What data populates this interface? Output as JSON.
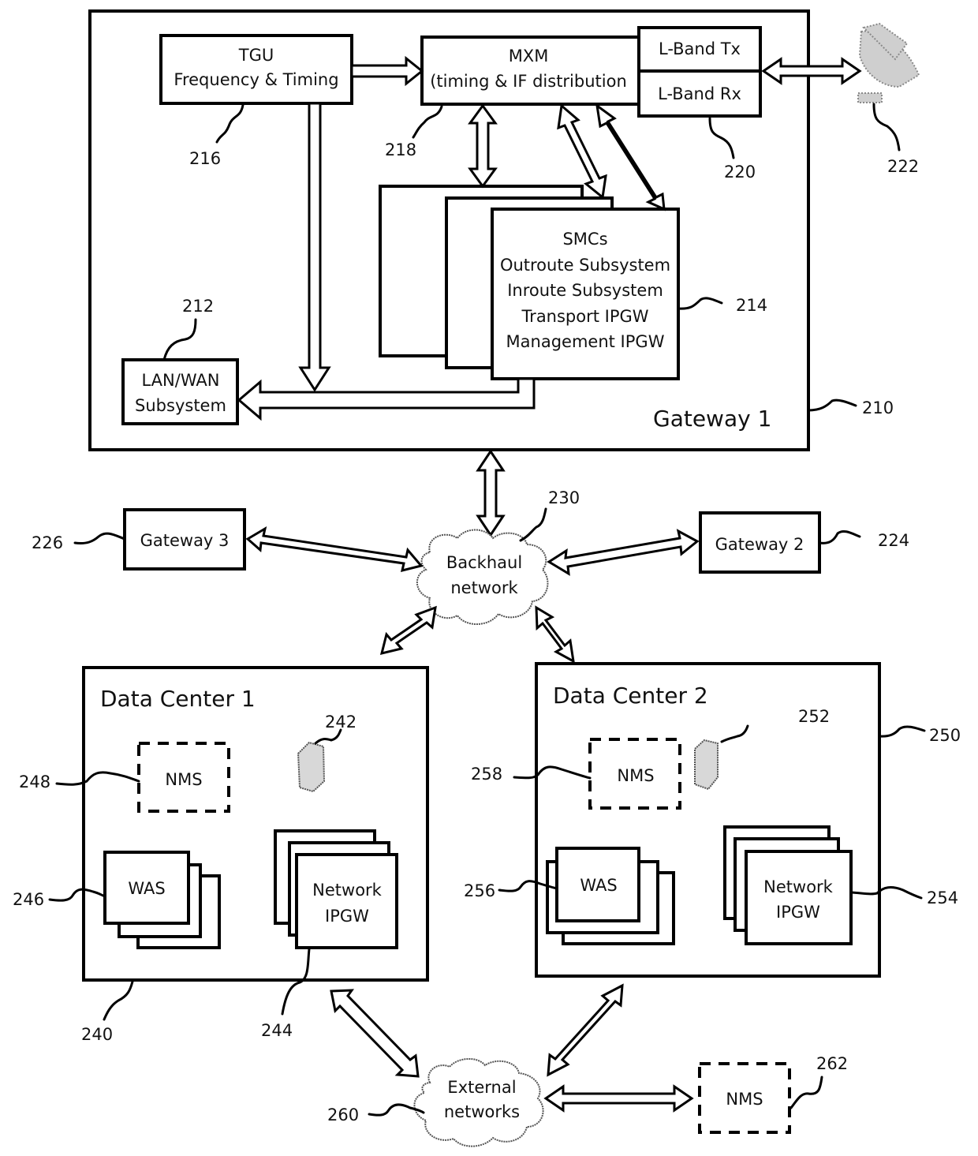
{
  "gateway1": {
    "title": "Gateway 1",
    "ref": "210",
    "tgu": {
      "line1": "TGU",
      "line2": "Frequency & Timing",
      "ref": "216"
    },
    "mxm": {
      "line1": "MXM",
      "line2": "(timing & IF distribution",
      "ref": "218"
    },
    "lband": {
      "tx": "L-Band Tx",
      "rx": "L-Band Rx",
      "ref": "220"
    },
    "antenna": {
      "ref": "222",
      "icon": "satellite-dish-icon"
    },
    "smc": {
      "lines": [
        "SMCs",
        "Outroute Subsystem",
        "Inroute Subsystem",
        "Transport IPGW",
        "Management IPGW"
      ],
      "ref": "214"
    },
    "lanwan": {
      "line1": "LAN/WAN",
      "line2": "Subsystem",
      "ref": "212"
    }
  },
  "backhaul": {
    "line1": "Backhaul",
    "line2": "network",
    "ref": "230"
  },
  "gateway2": {
    "label": "Gateway 2",
    "ref": "224"
  },
  "gateway3": {
    "label": "Gateway 3",
    "ref": "226"
  },
  "datacenter1": {
    "title": "Data Center 1",
    "ref": "240",
    "nms": {
      "label": "NMS",
      "ref": "248"
    },
    "server": {
      "ref": "242",
      "icon": "server-icon"
    },
    "was": {
      "label": "WAS",
      "ref": "246"
    },
    "ipgw": {
      "line1": "Network",
      "line2": "IPGW",
      "ref": "244"
    }
  },
  "datacenter2": {
    "title": "Data Center 2",
    "ref": "250",
    "nms": {
      "label": "NMS",
      "ref": "258"
    },
    "server": {
      "ref": "252",
      "icon": "server-icon"
    },
    "was": {
      "label": "WAS",
      "ref": "256"
    },
    "ipgw": {
      "line1": "Network",
      "line2": "IPGW",
      "ref": "254"
    }
  },
  "external": {
    "line1": "External",
    "line2": "networks",
    "ref": "260"
  },
  "nms_external": {
    "label": "NMS",
    "ref": "262"
  }
}
